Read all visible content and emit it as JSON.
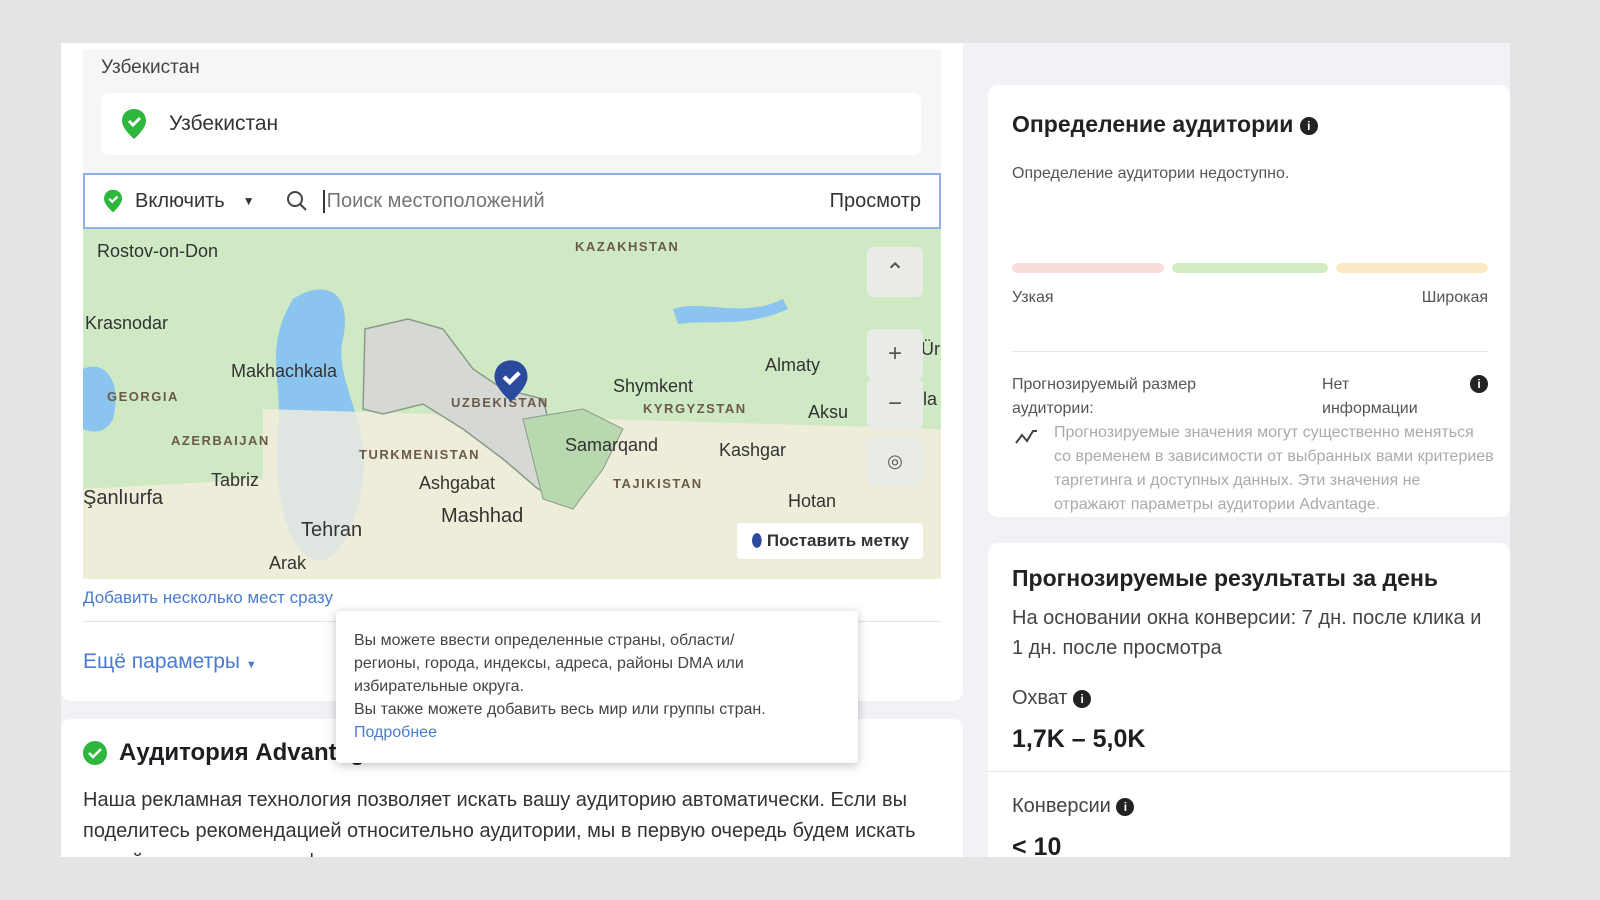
{
  "location": {
    "section_label": "Узбекистан",
    "selected": "Узбекистан",
    "include_label": "Включить",
    "search_placeholder": "Поиск местоположений",
    "view_label": "Просмотр"
  },
  "map": {
    "labels": [
      "Rostov-on-Don",
      "Krasnodar",
      "Makhachkala",
      "Almaty",
      "Shymkent",
      "Aksu",
      "Samarqand",
      "Kashgar",
      "Tabriz",
      "Ashgabat",
      "Şanlıurfa",
      "Mashhad",
      "Tehran",
      "Hotan",
      "Arak",
      "Korla",
      "Ür"
    ],
    "countries": [
      "KAZAKHSTAN",
      "GEORGIA",
      "UZBEKISTAN",
      "KYRGYZSTAN",
      "AZERBAIJAN",
      "TURKMENISTAN",
      "TAJIKISTAN"
    ],
    "drop_pin_label": "Поставить метку",
    "zoom_in": "+",
    "zoom_out": "−"
  },
  "add_many_link": "Добавить несколько мест сразу",
  "more_params": "Ещё параметры",
  "tooltip": {
    "line1": "Вы можете ввести определенные страны, области/",
    "line2": "регионы, города, индексы, адреса, районы DMA или",
    "line3": "избирательные округа.",
    "line4": "Вы также можете добавить весь мир или группы стран.",
    "link": "Подробнее"
  },
  "advantage": {
    "title": "Аудитория Advantage",
    "text": "Наша рекламная технология позволяет искать вашу аудиторию автоматически. Если вы поделитесь рекомендацией относительно аудитории, мы в первую очередь будем искать людей с указанным профилем, после чего расширим поиск."
  },
  "audience_def": {
    "title": "Определение аудитории",
    "unavailable": "Определение аудитории недоступно.",
    "narrow": "Узкая",
    "broad": "Широкая",
    "size_label": "Прогнозируемый размер аудитории:",
    "size_value": "Нет информации",
    "note": "Прогнозируемые значения могут существенно меняться со временем в зависимости от выбранных вами критериев таргетинга и доступных данных. Эти значения не отражают параметры аудитории Advantage.",
    "colors": {
      "narrow": "#f8dcd9",
      "good": "#d3ecc4",
      "broad": "#fbe8c4"
    }
  },
  "results": {
    "title": "Прогнозируемые результаты за день",
    "subtitle": "На основании окна конверсии: 7 дн. после клика и 1 дн. после просмотра",
    "reach_label": "Охват",
    "reach_value": "1,7K – 5,0K",
    "conv_label": "Конверсии",
    "conv_value": "< 10"
  }
}
